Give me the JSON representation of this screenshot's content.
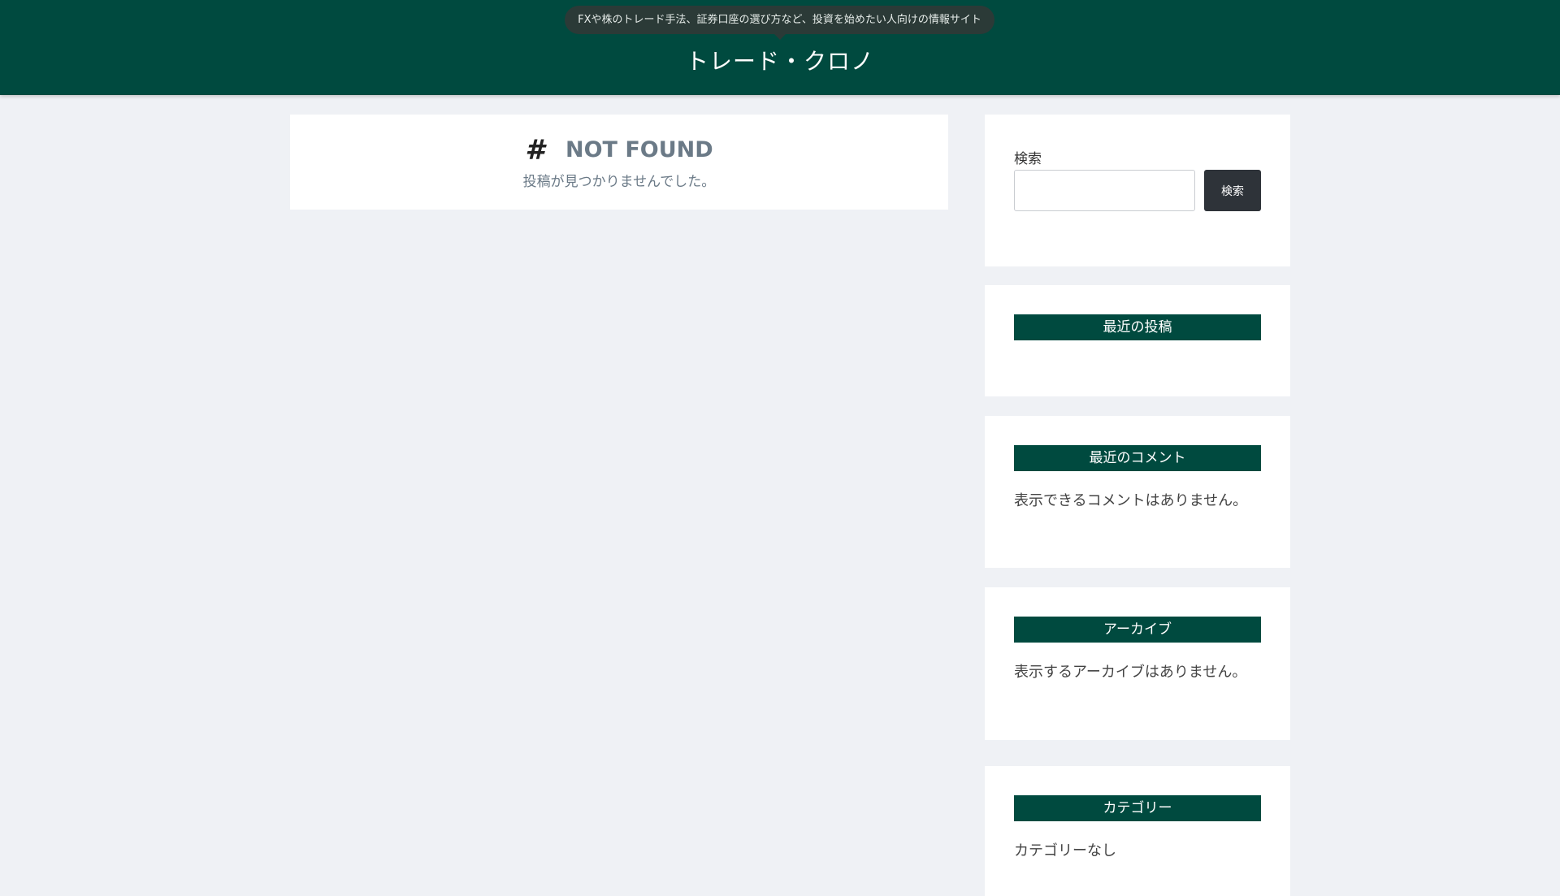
{
  "header": {
    "tagline": "FXや株のトレード手法、証券口座の選び方など、投資を始めたい人向けの情報サイト",
    "site_title": "トレード・クロノ"
  },
  "main": {
    "heading_icon": "hash-icon",
    "heading": "NOT FOUND",
    "message": "投稿が見つかりませんでした。"
  },
  "sidebar": {
    "search": {
      "label": "検索",
      "input_value": "",
      "button_label": "検索"
    },
    "recent_posts": {
      "title": "最近の投稿"
    },
    "recent_comments": {
      "title": "最近のコメント",
      "text": "表示できるコメントはありません。"
    },
    "archives": {
      "title": "アーカイブ",
      "text": "表示するアーカイブはありません。"
    },
    "categories": {
      "title": "カテゴリー",
      "text": "カテゴリーなし"
    }
  },
  "colors": {
    "header_bg": "#004a3f",
    "page_bg": "#eff1f5",
    "button_bg": "#2e3339"
  }
}
